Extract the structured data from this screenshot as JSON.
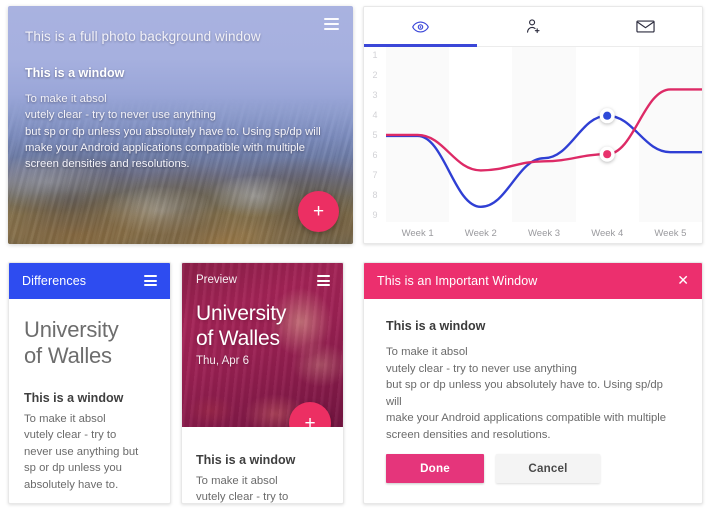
{
  "photo_window": {
    "title": "This is a full photo background window",
    "menu_icon": "hamburger-icon",
    "subtitle": "This is a window",
    "paragraph": "To make it absol\nvutely clear - try to never use anything\nbut sp or dp unless you absolutely have to. Using sp/dp will\nmake your Android applications compatible with multiple\nscreen densities and resolutions.",
    "fab_label": "+"
  },
  "chart_panel": {
    "tabs": [
      {
        "icon": "eye-icon",
        "active": true
      },
      {
        "icon": "person-add-icon",
        "active": false
      },
      {
        "icon": "mail-icon",
        "active": false
      }
    ],
    "active_accent": "#3b47d8"
  },
  "chart_data": {
    "type": "line",
    "title": "",
    "xlabel": "",
    "ylabel": "",
    "grid": false,
    "legend": "none",
    "categories": [
      "Week 1",
      "Week 2",
      "Week 3",
      "Week 4",
      "Week 5"
    ],
    "x_tick_labels": [
      "Week 1",
      "Week 2",
      "Week 3",
      "Week 4",
      "Week 5"
    ],
    "y_tick_labels": [
      "1",
      "2",
      "3",
      "4",
      "5",
      "6",
      "7",
      "8",
      "9"
    ],
    "ylim": [
      1,
      9
    ],
    "y_axis_inverted": true,
    "series": [
      {
        "name": "blue-series",
        "color": "#2f3fd4",
        "values": [
          5.1,
          8.6,
          6.2,
          4.1,
          5.9
        ],
        "marker": {
          "at_category": "Week 4",
          "value": 4.1,
          "color": "#2f4bd8"
        }
      },
      {
        "name": "pink-series",
        "color": "#dd2a66",
        "values": [
          5.05,
          6.8,
          6.35,
          6.0,
          2.8
        ],
        "marker": {
          "at_category": "Week 4",
          "value": 6.0,
          "color": "#e8336d"
        }
      }
    ]
  },
  "differences_window": {
    "bar_title": "Differences",
    "bar_color": "#2e4cf0",
    "menu_icon": "hamburger-icon",
    "heading": "University\nof Walles",
    "section_title": "This is a window",
    "section_text": "To make it absol\nvutely clear - try to\nnever use anything but\nsp or dp unless you\nabsolutely have to."
  },
  "preview_window": {
    "bar_title": "Preview",
    "menu_icon": "hamburger-icon",
    "heading": "University\nof Walles",
    "date": "Thu, Apr 6",
    "fab_label": "+",
    "section_title": "This is a window",
    "section_text": "To make it absol\nvutely clear - try to"
  },
  "important_window": {
    "bar_title": "This is an Important Window",
    "bar_color": "#ec2f6e",
    "close_icon": "close-icon",
    "heading": "This is a window",
    "body": "To make it absol\nvutely clear - try to never use anything\nbut sp or dp unless you absolutely have to. Using sp/dp will\nmake your Android applications compatible with multiple\nscreen densities and resolutions.",
    "primary_button": "Done",
    "secondary_button": "Cancel"
  }
}
